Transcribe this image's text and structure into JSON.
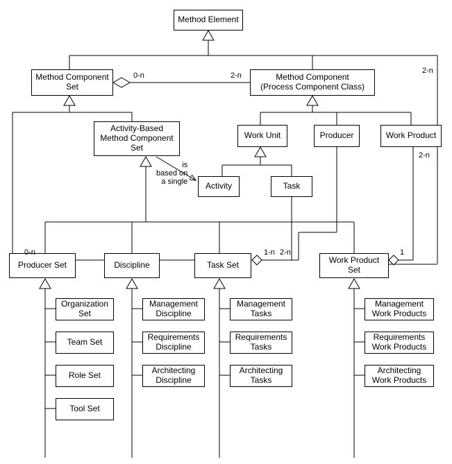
{
  "nodes": {
    "method_element": "Method Element",
    "method_component_set": "Method Component\nSet",
    "method_component_pcc": "Method Component\n(Process Component Class)",
    "activity_based_mcs": "Activity-Based\nMethod Component\nSet",
    "work_unit": "Work Unit",
    "producer": "Producer",
    "work_product": "Work Product",
    "activity": "Activity",
    "task": "Task",
    "producer_set": "Producer Set",
    "discipline": "Discipline",
    "task_set": "Task Set",
    "work_product_set": "Work Product\nSet",
    "organization_set": "Organization\nSet",
    "team_set": "Team Set",
    "role_set": "Role Set",
    "tool_set": "Tool Set",
    "management_discipline": "Management\nDiscipline",
    "requirements_discipline": "Requirements\nDiscipline",
    "architecting_discipline": "Architecting\nDiscipline",
    "management_tasks": "Management\nTasks",
    "requirements_tasks": "Requirements\nTasks",
    "architecting_tasks": "Architecting\nTasks",
    "management_wp": "Management\nWork Products",
    "requirements_wp": "Requirements\nWork Products",
    "architecting_wp": "Architecting\nWork Products"
  },
  "labels": {
    "agg_0n_a": "0-n",
    "agg_2n_a": "2-n",
    "right_2n": "2-n",
    "right_lower_2n": "2-n",
    "based_on": "is\nbased on\na single",
    "ps_0n": "0-n",
    "ps_2n": "2-n",
    "ts_1n": "1-n",
    "wps_1": "1"
  }
}
